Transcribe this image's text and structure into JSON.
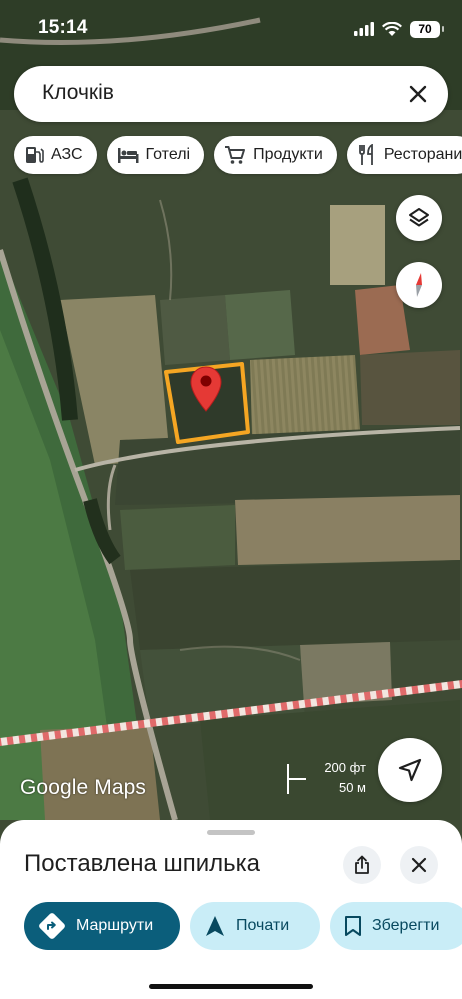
{
  "status_bar": {
    "time": "15:14",
    "battery": "70"
  },
  "search": {
    "query": "Клочків"
  },
  "chips": [
    {
      "icon": "gas-station-icon",
      "label": "АЗС"
    },
    {
      "icon": "bed-icon",
      "label": "Готелі"
    },
    {
      "icon": "cart-icon",
      "label": "Продукти"
    },
    {
      "icon": "restaurant-icon",
      "label": "Ресторани"
    }
  ],
  "map": {
    "logo": "Google Maps",
    "scale_imperial": "200 фт",
    "scale_metric": "50 м",
    "pin_color": "#e53935",
    "outline_color": "#f5a623"
  },
  "sheet": {
    "title": "Поставлена шпилька",
    "buttons": {
      "directions": "Маршрути",
      "start": "Почати",
      "save": "Зберегти"
    },
    "colors": {
      "primary": "#0b5e7b",
      "secondary": "#c9edf7"
    }
  }
}
